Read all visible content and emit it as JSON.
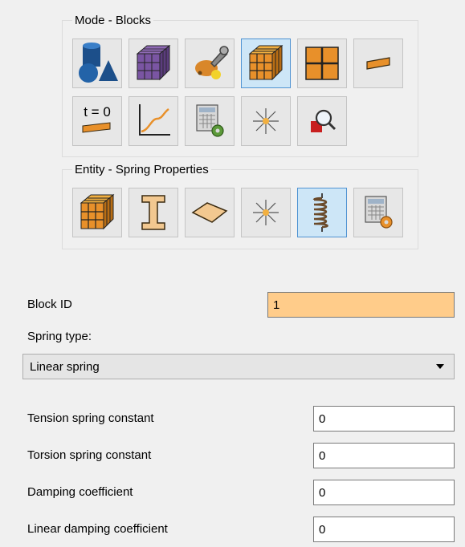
{
  "mode_group": {
    "title": "Mode - Blocks",
    "tools": [
      {
        "icon": "geometry-shapes-icon",
        "active": false
      },
      {
        "icon": "mesh-cube-icon",
        "active": false
      },
      {
        "icon": "wrench-settings-icon",
        "active": false
      },
      {
        "icon": "blocks-cube-icon",
        "active": true
      },
      {
        "icon": "surface-grid-icon",
        "active": false
      },
      {
        "icon": "beam-element-icon",
        "active": false
      },
      {
        "icon": "initial-condition-icon",
        "label": "t = 0",
        "active": false
      },
      {
        "icon": "curve-graph-icon",
        "active": false
      },
      {
        "icon": "calculator-gear-icon",
        "active": false
      },
      {
        "icon": "point-burst-icon",
        "active": false
      },
      {
        "icon": "zoom-inspect-icon",
        "active": false
      }
    ]
  },
  "entity_group": {
    "title": "Entity - Spring Properties",
    "tools": [
      {
        "icon": "blocks-cube-icon",
        "active": false
      },
      {
        "icon": "ibeam-icon",
        "active": false
      },
      {
        "icon": "shell-plate-icon",
        "active": false
      },
      {
        "icon": "point-burst-icon",
        "active": false
      },
      {
        "icon": "spring-coil-icon",
        "active": true
      },
      {
        "icon": "calculator-gear-icon",
        "active": false
      }
    ]
  },
  "form": {
    "block_id_label": "Block ID",
    "block_id_value": "1",
    "spring_type_label": "Spring type:",
    "spring_type_value": "Linear spring",
    "tension_label": "Tension spring constant",
    "tension_value": "0",
    "torsion_label": "Torsion spring constant",
    "torsion_value": "0",
    "damping_label": "Damping coefficient",
    "damping_value": "0",
    "linear_damping_label": "Linear damping coefficient",
    "linear_damping_value": "0"
  },
  "colors": {
    "highlight_field": "#ffcc8a",
    "active_tool_bg": "#cde6f7",
    "active_tool_border": "#4f93d2",
    "orange": "#e8902a"
  }
}
